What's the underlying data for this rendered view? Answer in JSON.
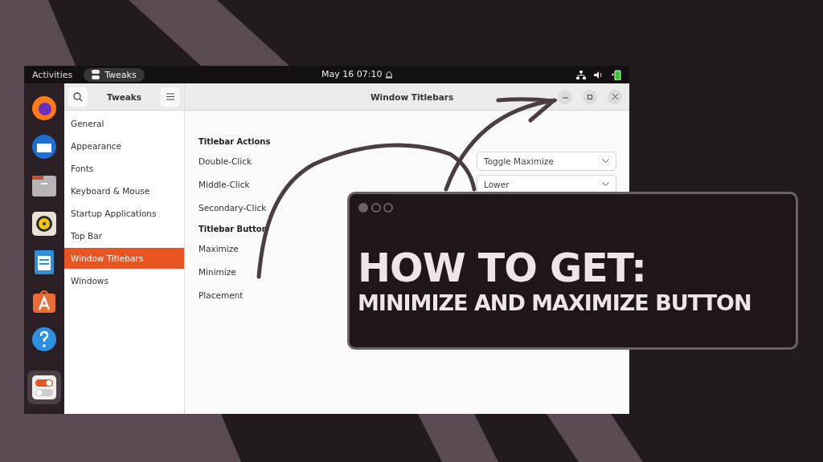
{
  "top_bar": {
    "activities": "Activities",
    "app": "Tweaks",
    "clock": "May 16  07:10"
  },
  "dock": [
    {
      "kind": "browser",
      "running": false
    },
    {
      "kind": "mail",
      "running": false
    },
    {
      "kind": "folder",
      "running": false
    },
    {
      "kind": "speaker",
      "running": false
    },
    {
      "kind": "document",
      "running": false
    },
    {
      "kind": "store",
      "running": false
    },
    {
      "kind": "help",
      "running": false
    },
    {
      "kind": "toggles",
      "running": true
    }
  ],
  "sidebar": {
    "title": "Tweaks",
    "items": [
      {
        "label": "General",
        "selected": false
      },
      {
        "label": "Appearance",
        "selected": false
      },
      {
        "label": "Fonts",
        "selected": false
      },
      {
        "label": "Keyboard & Mouse",
        "selected": false
      },
      {
        "label": "Startup Applications",
        "selected": false
      },
      {
        "label": "Top Bar",
        "selected": false
      },
      {
        "label": "Window Titlebars",
        "selected": true
      },
      {
        "label": "Windows",
        "selected": false
      }
    ]
  },
  "content": {
    "title": "Window Titlebars",
    "sections": [
      {
        "heading": "Titlebar Actions",
        "rows": [
          {
            "label": "Double-Click",
            "value": "Toggle Maximize"
          },
          {
            "label": "Middle-Click",
            "value": "Lower"
          },
          {
            "label": "Secondary-Click"
          }
        ]
      },
      {
        "heading": "Titlebar Button",
        "rows": [
          {
            "label": "Maximize"
          },
          {
            "label": "Minimize"
          },
          {
            "label": "Placement"
          }
        ]
      }
    ]
  },
  "banner": {
    "heading": "HOW TO GET:",
    "subheading": "MINIMIZE AND MAXIMIZE BUTTON"
  }
}
